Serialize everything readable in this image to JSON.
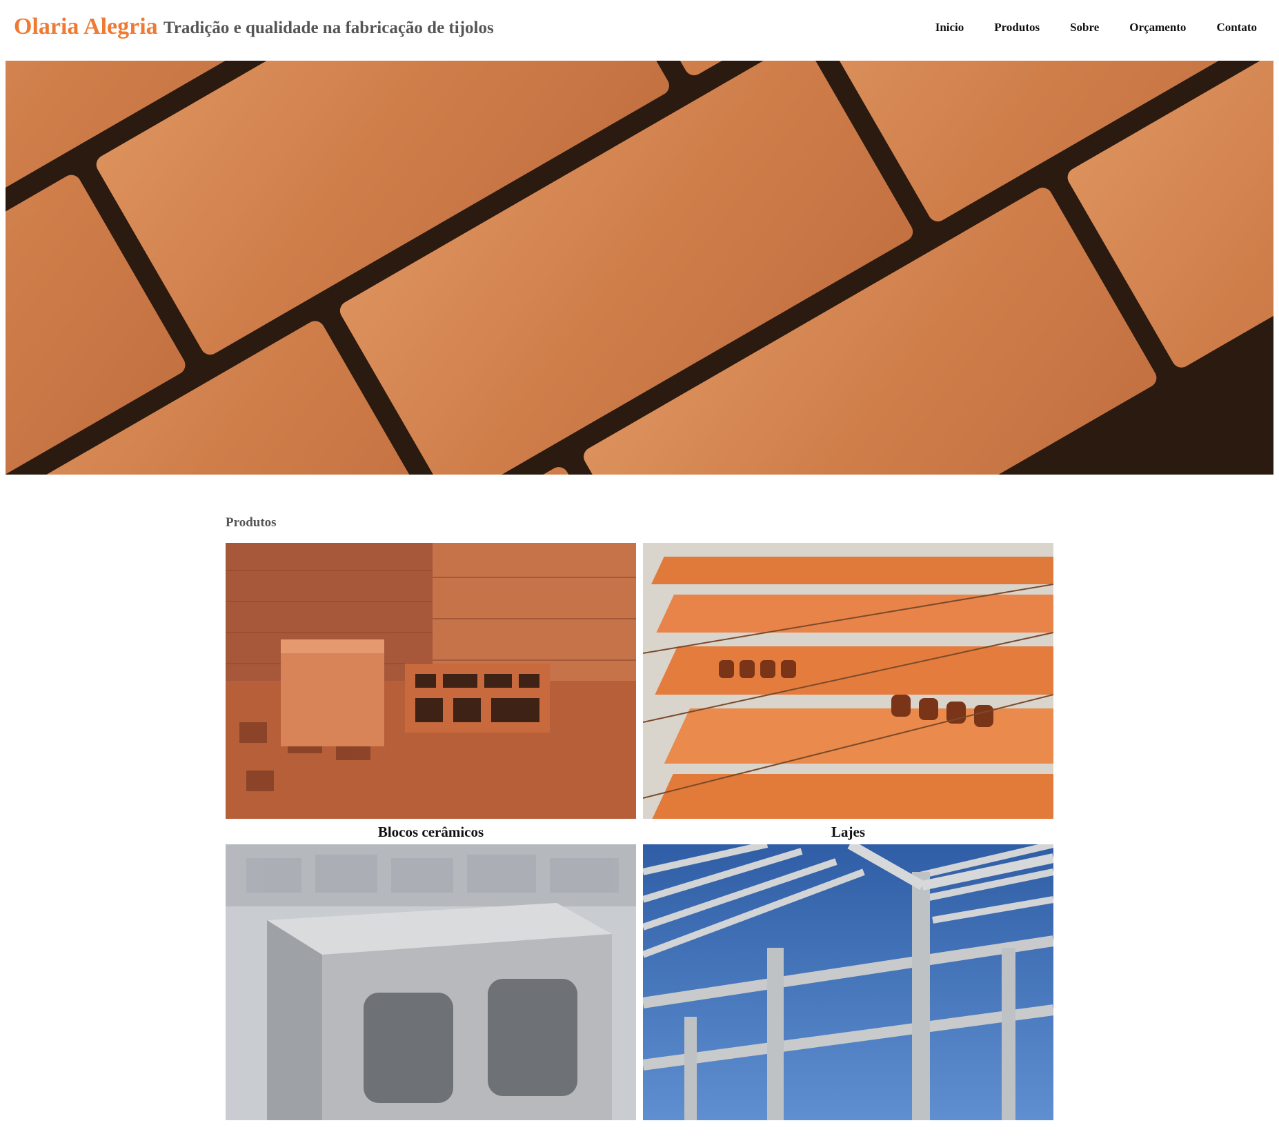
{
  "header": {
    "brand": "Olaria Alegria",
    "tagline": "Tradição e qualidade na fabricação de tijolos"
  },
  "nav": {
    "items": [
      {
        "label": "Inicio"
      },
      {
        "label": "Produtos"
      },
      {
        "label": "Sobre"
      },
      {
        "label": "Orçamento"
      },
      {
        "label": "Contato"
      }
    ]
  },
  "products": {
    "title": "Produtos",
    "items": [
      {
        "label": "Blocos cerâmicos"
      },
      {
        "label": "Lajes"
      },
      {
        "label": ""
      },
      {
        "label": ""
      }
    ]
  },
  "colors": {
    "brand": "#ee7a34",
    "tagline": "#555555",
    "brick": "#d3824f"
  }
}
